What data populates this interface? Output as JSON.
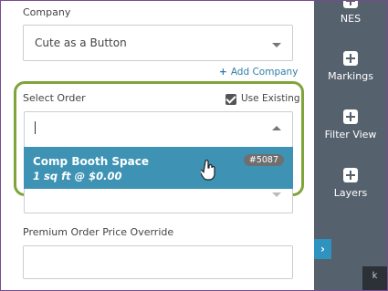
{
  "company": {
    "label": "Company",
    "value": "Cute as a Button",
    "add_label": "Add Company"
  },
  "order": {
    "label": "Select Order",
    "use_existing_label": "Use Existing",
    "use_existing_checked": true,
    "input_value": "",
    "options": [
      {
        "name": "Comp Booth Space",
        "detail": "1 sq ft @ $0.00",
        "id_badge": "#5087"
      }
    ]
  },
  "premium": {
    "label": "Premium Order Price Override",
    "value": ""
  },
  "sidebar": {
    "items": [
      {
        "label": "NES",
        "icon": "plus-square-icon"
      },
      {
        "label": "Markings",
        "icon": "plus-square-icon"
      },
      {
        "label": "Filter View",
        "icon": "plus-square-icon"
      },
      {
        "label": "Layers",
        "icon": "plus-square-icon"
      }
    ],
    "collapse_glyph": "›",
    "corner_glyph": "k"
  },
  "colors": {
    "accent": "#3e93b4",
    "highlight_border": "#7fa43a",
    "sidebar_bg": "#56616e",
    "link": "#2e7fa8"
  }
}
